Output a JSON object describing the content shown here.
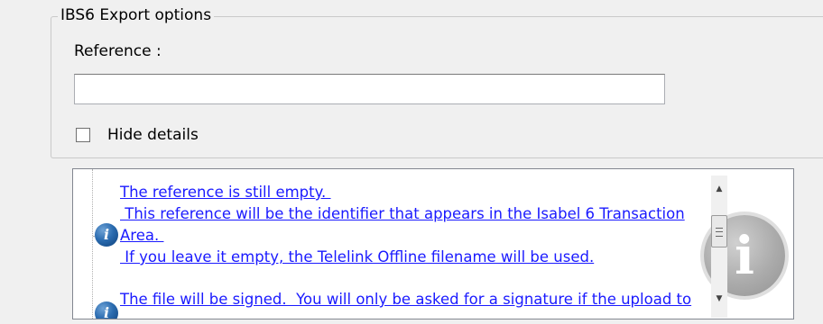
{
  "export_options": {
    "group_title": "IBS6 Export options",
    "reference_label": "Reference :",
    "reference_value": "",
    "hide_details_label": "Hide details",
    "hide_details_checked": false
  },
  "messages": [
    {
      "icon": "info-icon",
      "lines": [
        "The reference is still empty. ",
        " This reference will be the identifier that appears in the Isabel 6 Transaction",
        "Area. ",
        " If you leave it empty, the Telelink Offline filename will be used."
      ]
    },
    {
      "icon": "info-icon",
      "lines": [
        "The file will be signed.  You will only be asked for a signature if the upload to"
      ]
    }
  ],
  "watermark_icon": "info-icon",
  "colors": {
    "link": "#1a1aff",
    "background": "#f0f0f0",
    "panel": "#ffffff"
  }
}
